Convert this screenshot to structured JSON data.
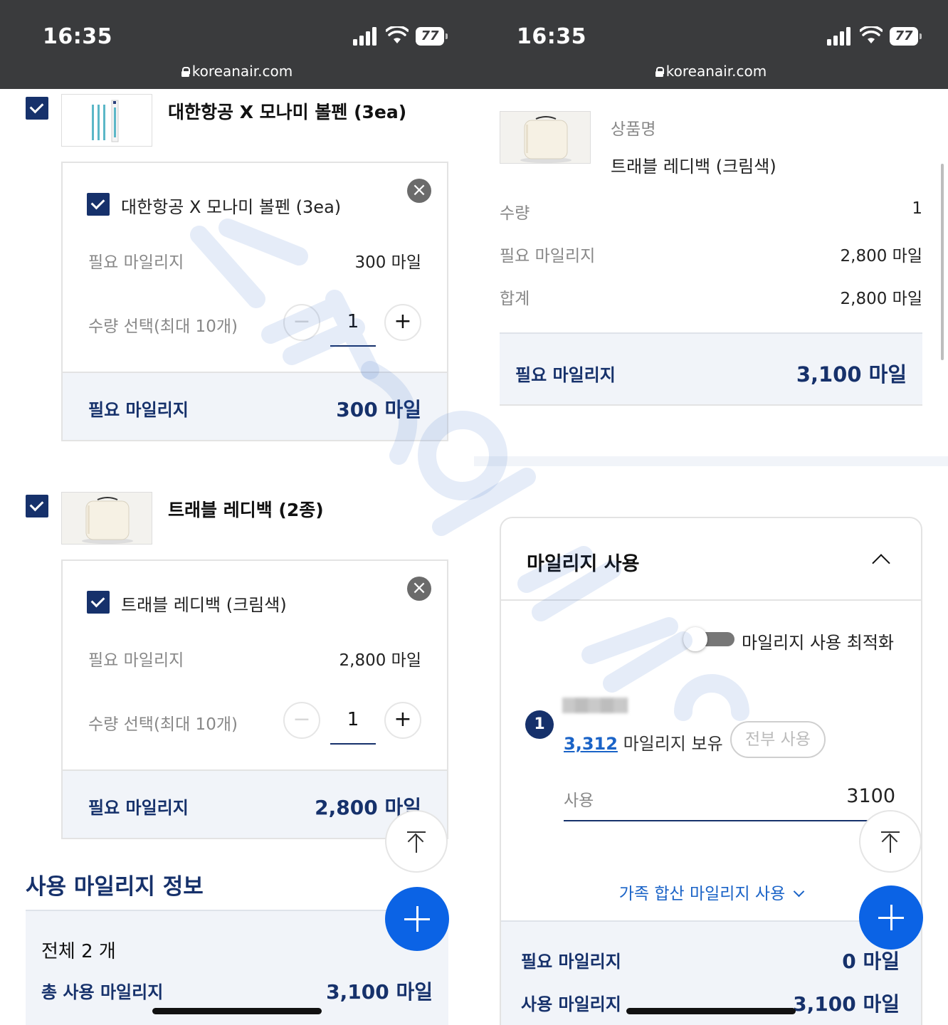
{
  "status_bar": {
    "time": "16:35",
    "battery": "77",
    "url": "koreanair.com"
  },
  "left": {
    "product1": {
      "title": "대한항공 X 모나미 볼펜 (3ea)",
      "option_name": "대한항공 X 모나미 볼펜 (3ea)",
      "required_label": "필요 마일리지",
      "required_value": "300 마일",
      "qty_label": "수량 선택(최대 10개)",
      "qty": "1",
      "foot_label": "필요 마일리지",
      "foot_value": "300 마일"
    },
    "product2": {
      "title": "트래블 레디백 (2종)",
      "option_name": "트래블 레디백 (크림색)",
      "required_label": "필요 마일리지",
      "required_value": "2,800 마일",
      "qty_label": "수량 선택(최대 10개)",
      "qty": "1",
      "foot_label": "필요 마일리지",
      "foot_value": "2,800 마일"
    },
    "section_title": "사용 마일리지 정보",
    "summary": {
      "total_count": "전체 2 개",
      "total_label": "총 사용 마일리지",
      "total_value": "3,100 마일"
    }
  },
  "right": {
    "product": {
      "name_label": "상품명",
      "name_value": "트래블 레디백 (크림색)",
      "qty_label": "수량",
      "qty_value": "1",
      "required_label": "필요 마일리지",
      "required_value": "2,800 마일",
      "sum_label": "합계",
      "sum_value": "2,800 마일"
    },
    "total": {
      "label": "필요 마일리지",
      "value": "3,100 마일"
    },
    "mileage_card": {
      "title": "마일리지 사용",
      "optimize_label": "마일리지 사용 최적화",
      "badge": "1",
      "balance_value": "3,312",
      "balance_label": "마일리지 보유",
      "use_all": "전부 사용",
      "use_label": "사용",
      "use_value": "3100",
      "family_link": "가족 합산 마일리지 사용",
      "required_label": "필요 마일리지",
      "required_value": "0 마일",
      "used_label": "사용 마일리지",
      "used_value": "3,100 마일"
    }
  },
  "icons": [
    "check-icon",
    "close-icon",
    "minus-icon",
    "plus-icon",
    "scroll-top-icon",
    "add-icon",
    "chevron-up-icon",
    "chevron-down-icon",
    "lock-icon",
    "signal-icon",
    "wifi-icon",
    "battery-icon"
  ],
  "colors": {
    "navy": "#16316b",
    "fab_blue": "#0b63e5",
    "link_blue": "#1a63c7",
    "status_bar": "#3a3b3d",
    "summary_bg": "#f1f4f9"
  }
}
